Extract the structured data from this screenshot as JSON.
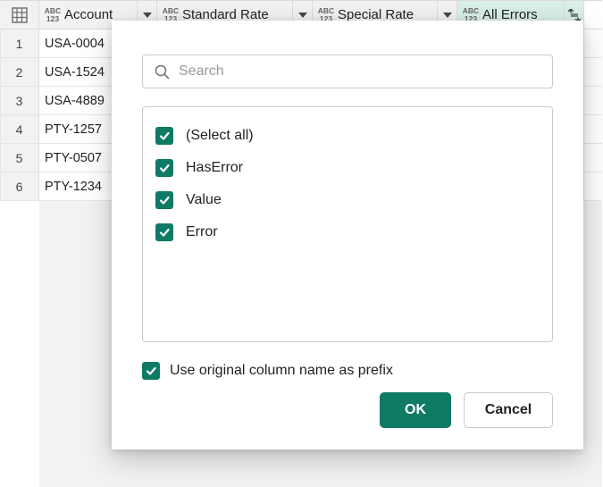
{
  "columns": [
    {
      "label": "Account"
    },
    {
      "label": "Standard Rate"
    },
    {
      "label": "Special Rate"
    },
    {
      "label": "All Errors"
    }
  ],
  "rows": [
    {
      "num": "1",
      "account": "USA-0004"
    },
    {
      "num": "2",
      "account": "USA-1524"
    },
    {
      "num": "3",
      "account": "USA-4889"
    },
    {
      "num": "4",
      "account": "PTY-1257"
    },
    {
      "num": "5",
      "account": "PTY-0507"
    },
    {
      "num": "6",
      "account": "PTY-1234"
    }
  ],
  "popup": {
    "search_placeholder": "Search",
    "items": [
      {
        "label": "(Select all)"
      },
      {
        "label": "HasError"
      },
      {
        "label": "Value"
      },
      {
        "label": "Error"
      }
    ],
    "prefix_label": "Use original column name as prefix",
    "ok_label": "OK",
    "cancel_label": "Cancel"
  }
}
